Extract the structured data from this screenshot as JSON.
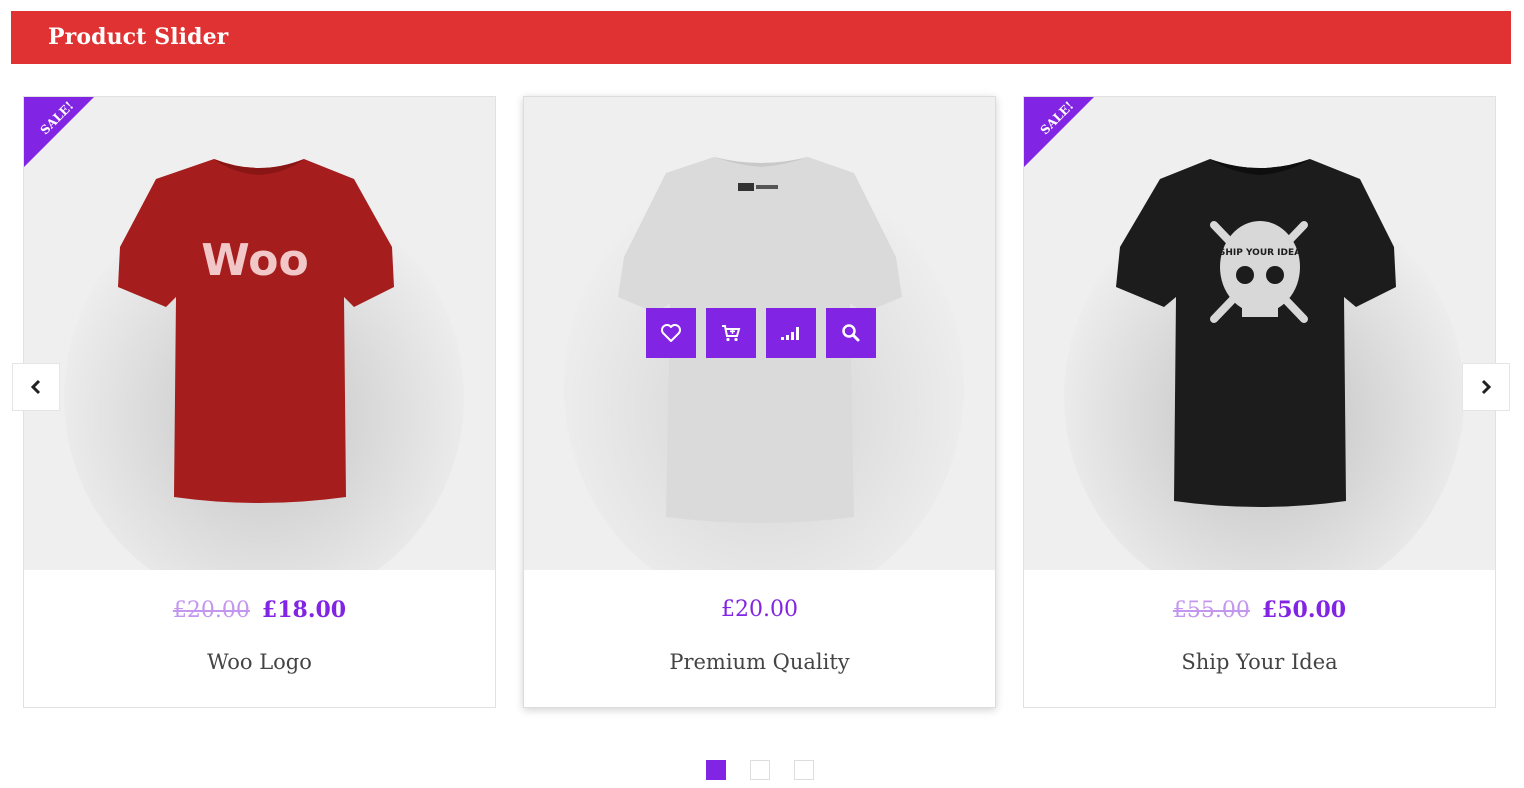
{
  "header": {
    "title": "Product Slider"
  },
  "colors": {
    "header_bg": "#e03232",
    "accent": "#8224e3",
    "old_price": "#c497ee"
  },
  "products": [
    {
      "name": "Woo Logo",
      "old_price": "£20.00",
      "price": "£18.00",
      "badge": "SALE!",
      "shirt_color": "#a61d1d",
      "print": "Woo"
    },
    {
      "name": "Premium Quality",
      "price": "£20.00",
      "shirt_color": "#dadada"
    },
    {
      "name": "Ship Your Idea",
      "old_price": "£55.00",
      "price": "£50.00",
      "badge": "SALE!",
      "shirt_color": "#1c1c1c",
      "print": "SHIP YOUR IDEA"
    }
  ],
  "hover_actions": [
    {
      "icon": "heart-icon"
    },
    {
      "icon": "cart-icon"
    },
    {
      "icon": "compare-icon"
    },
    {
      "icon": "search-icon"
    }
  ],
  "navigation": {
    "prev_icon": "chevron-left-icon",
    "next_icon": "chevron-right-icon"
  },
  "pagination": {
    "pages": 3,
    "current": 1
  }
}
